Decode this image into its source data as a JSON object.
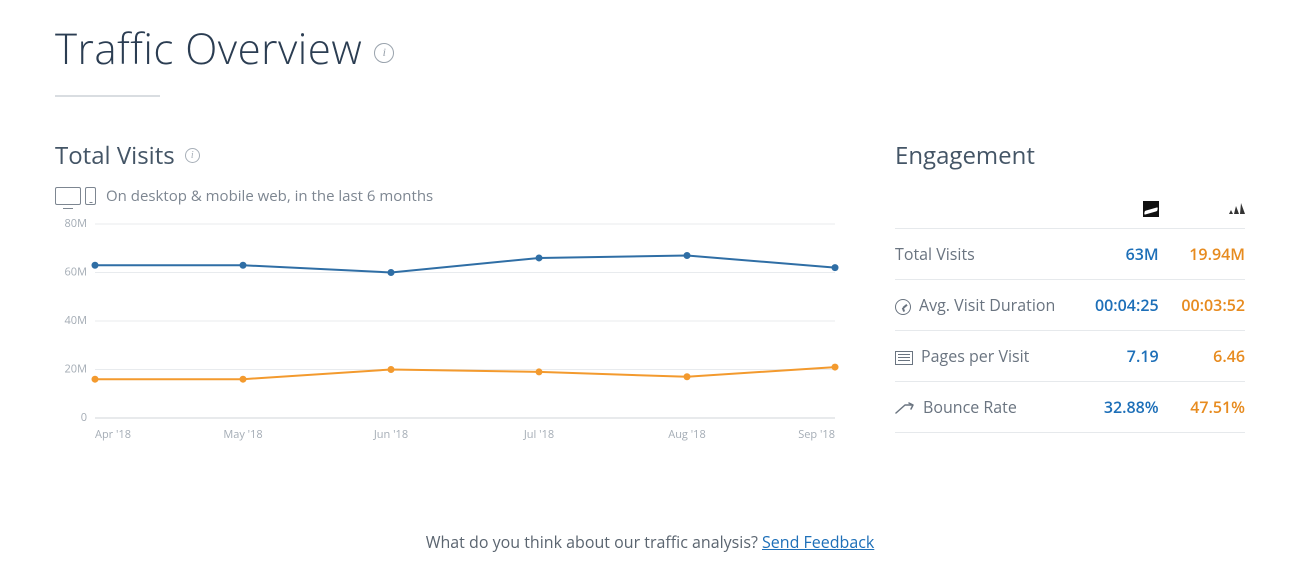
{
  "header": {
    "title": "Traffic Overview"
  },
  "visits": {
    "title": "Total Visits",
    "subtitle": "On desktop & mobile web, in the last 6 months"
  },
  "engagement": {
    "title": "Engagement",
    "rows": {
      "total_visits": {
        "label": "Total Visits",
        "a": "63M",
        "b": "19.94M"
      },
      "avg_duration": {
        "label": "Avg. Visit Duration",
        "a": "00:04:25",
        "b": "00:03:52"
      },
      "pages_per_visit": {
        "label": "Pages per Visit",
        "a": "7.19",
        "b": "6.46"
      },
      "bounce_rate": {
        "label": "Bounce Rate",
        "a": "32.88%",
        "b": "47.51%"
      }
    },
    "brands": {
      "a": "nike",
      "b": "adidas"
    }
  },
  "feedback": {
    "prompt": "What do you think about our traffic analysis? ",
    "link_text": "Send Feedback"
  },
  "chart_data": {
    "type": "line",
    "title": "Total Visits",
    "xlabel": "",
    "ylabel": "",
    "ylim": [
      0,
      80
    ],
    "y_unit": "M",
    "y_ticks": [
      "0",
      "20M",
      "40M",
      "60M",
      "80M"
    ],
    "categories": [
      "Apr '18",
      "May '18",
      "Jun '18",
      "Jul '18",
      "Aug '18",
      "Sep '18"
    ],
    "series": [
      {
        "name": "nike",
        "color": "#2f6ea5",
        "values": [
          63,
          63,
          60,
          66,
          67,
          62
        ]
      },
      {
        "name": "adidas",
        "color": "#f39a2e",
        "values": [
          16,
          16,
          20,
          19,
          17,
          21
        ]
      }
    ]
  }
}
